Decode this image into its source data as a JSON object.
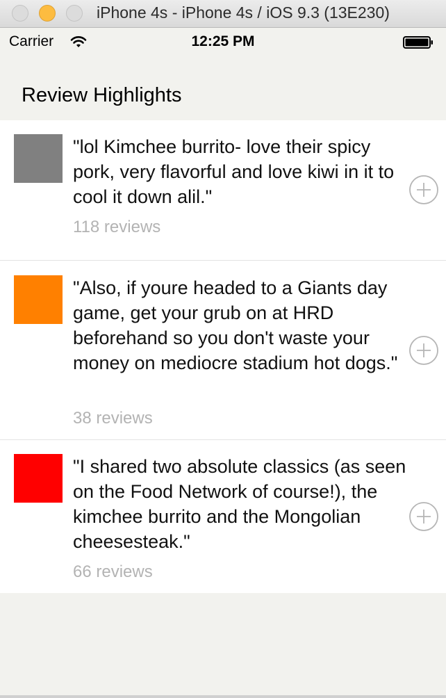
{
  "window": {
    "title": "iPhone 4s - iPhone 4s / iOS 9.3 (13E230)"
  },
  "status_bar": {
    "carrier": "Carrier",
    "time": "12:25 PM"
  },
  "nav": {
    "title": "Review Highlights"
  },
  "reviews": [
    {
      "color": "#808080",
      "quote": "\"lol Kimchee burrito- love their spicy pork, very flavorful and love kiwi in it to cool it down alil.\"",
      "count": "118 reviews"
    },
    {
      "color": "#ff8000",
      "quote": "\"Also, if youre headed to a Giants day game, get your grub on at HRD beforehand so you don't waste your money on mediocre stadium hot dogs.\"",
      "count": "38 reviews"
    },
    {
      "color": "#ff0000",
      "quote": "\"I shared two absolute classics (as seen on the Food Network of course!), the kimchee burrito and the Mongolian cheesesteak.\"",
      "count": "66 reviews"
    }
  ]
}
